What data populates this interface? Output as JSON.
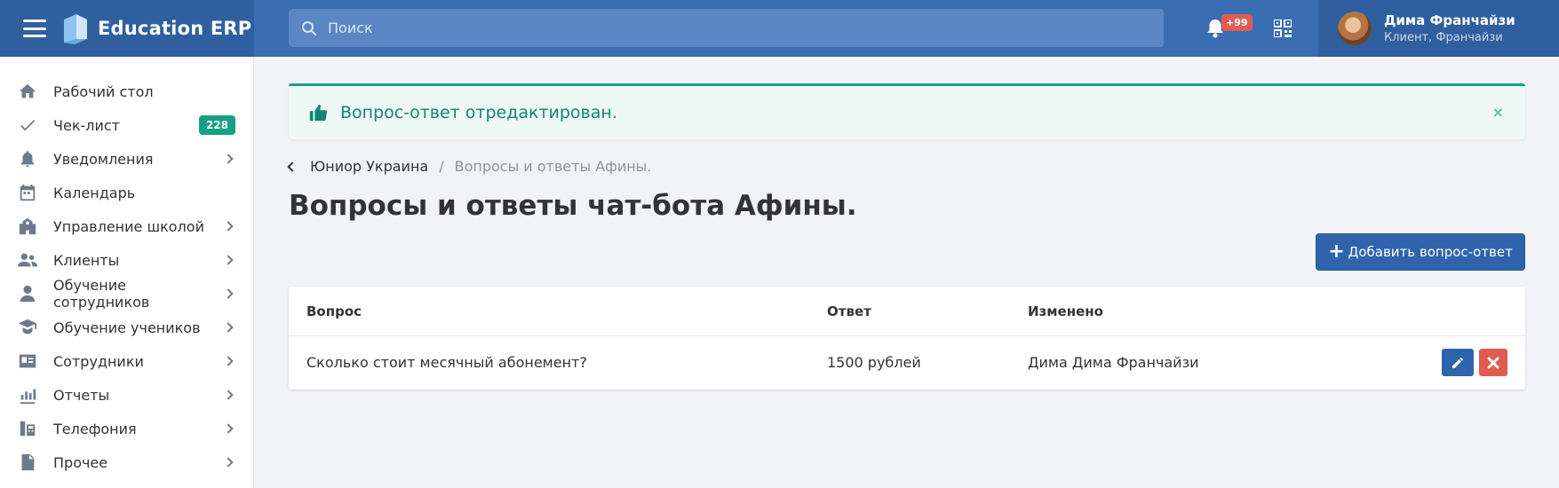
{
  "app": {
    "title": "Education ERP"
  },
  "search": {
    "placeholder": "Поиск"
  },
  "notifications": {
    "badge": "+99"
  },
  "user": {
    "name": "Дима Франчайзи",
    "role": "Клиент, Франчайзи"
  },
  "sidebar": {
    "items": [
      {
        "label": "Рабочий стол",
        "icon": "home-icon"
      },
      {
        "label": "Чек-лист",
        "icon": "check-icon",
        "badge": "228"
      },
      {
        "label": "Уведомления",
        "icon": "bell-icon",
        "has_submenu": true
      },
      {
        "label": "Календарь",
        "icon": "calendar-icon"
      },
      {
        "label": "Управление школой",
        "icon": "school-icon",
        "has_submenu": true
      },
      {
        "label": "Клиенты",
        "icon": "users-icon",
        "has_submenu": true
      },
      {
        "label": "Обучение сотрудников",
        "icon": "staff-training-icon",
        "has_submenu": true
      },
      {
        "label": "Обучение учеников",
        "icon": "graduation-cap-icon",
        "has_submenu": true
      },
      {
        "label": "Сотрудники",
        "icon": "id-card-icon",
        "has_submenu": true
      },
      {
        "label": "Отчеты",
        "icon": "chart-icon",
        "has_submenu": true
      },
      {
        "label": "Телефония",
        "icon": "phone-icon",
        "has_submenu": true
      },
      {
        "label": "Прочее",
        "icon": "document-icon",
        "has_submenu": true
      }
    ]
  },
  "alert": {
    "text": "Вопрос-ответ отредактирован.",
    "close": "×"
  },
  "breadcrumb": {
    "parent": "Юниор Украина",
    "separator": "/",
    "current": "Вопросы и ответы Афины."
  },
  "page": {
    "title": "Вопросы и ответы чат-бота Афины."
  },
  "actions": {
    "add_label": "Добавить вопрос-ответ"
  },
  "table": {
    "headers": [
      "Вопрос",
      "Ответ",
      "Изменено"
    ],
    "rows": [
      {
        "question": "Сколько стоит месячный абонемент?",
        "answer": "1500 рублей",
        "modified": "Дима Дима Франчайзи"
      }
    ]
  },
  "colors": {
    "topbar": "#3a6db2",
    "brand": "#2f5f9f",
    "success": "#17a086",
    "primary": "#2f64ad",
    "danger": "#e05b52"
  }
}
